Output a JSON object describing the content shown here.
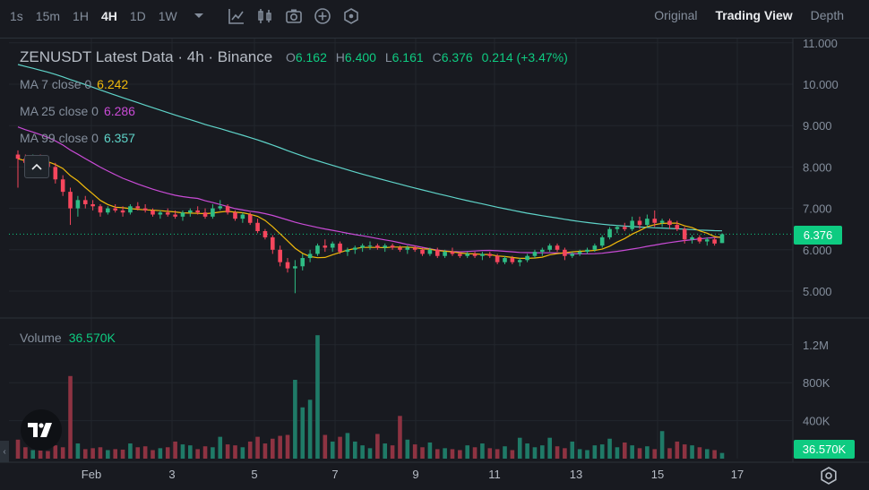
{
  "toolbar": {
    "timeframes": [
      "1s",
      "15m",
      "1H",
      "4H",
      "1D",
      "1W"
    ],
    "active_timeframe": "4H",
    "views": [
      "Original",
      "Trading View",
      "Depth"
    ],
    "active_view": "Trading View"
  },
  "legend": {
    "title": "ZENUSDT Latest Data · 4h · Binance",
    "open_key": "O",
    "open": "6.162",
    "high_key": "H",
    "high": "6.400",
    "low_key": "L",
    "low": "6.161",
    "close_key": "C",
    "close": "6.376",
    "change": "0.214 (+3.47%)"
  },
  "ma": [
    {
      "label": "MA 7 close 0",
      "value": "6.242",
      "color": "#f0b90b"
    },
    {
      "label": "MA 25 close 0",
      "value": "6.286",
      "color": "#c94bd6"
    },
    {
      "label": "MA 99 close 0",
      "value": "6.357",
      "color": "#5fd4c9"
    }
  ],
  "volume": {
    "label": "Volume",
    "value": "36.570K",
    "tag": "36.570K"
  },
  "price_tag": "6.376",
  "colors": {
    "up": "#2ebd85",
    "down": "#f6465d",
    "up_vol": "#1f7a67",
    "down_vol": "#8e3342"
  },
  "chart_data": {
    "type": "candlestick",
    "price_axis": {
      "ticks": [
        "11.000",
        "10.000",
        "9.000",
        "8.000",
        "7.000",
        "6.000",
        "5.000"
      ],
      "min": 4.5,
      "max": 11.2
    },
    "volume_axis": {
      "ticks": [
        "1.2M",
        "800K",
        "400K"
      ],
      "max": 1300000
    },
    "x_ticks": [
      "Feb",
      "3",
      "5",
      "7",
      "9",
      "11",
      "13",
      "15",
      "17"
    ],
    "last_price": 6.376,
    "ohlc": [
      [
        8.3,
        8.4,
        7.5,
        8.2
      ],
      [
        8.2,
        8.3,
        7.9,
        8.1
      ],
      [
        8.1,
        8.3,
        8.0,
        8.25
      ],
      [
        8.25,
        8.3,
        8.05,
        8.1
      ],
      [
        8.1,
        8.2,
        7.9,
        8.0
      ],
      [
        8.0,
        8.1,
        7.6,
        7.7
      ],
      [
        7.7,
        7.8,
        7.3,
        7.4
      ],
      [
        7.4,
        7.5,
        6.6,
        7.0
      ],
      [
        7.0,
        7.3,
        6.8,
        7.2
      ],
      [
        7.2,
        7.3,
        7.0,
        7.1
      ],
      [
        7.1,
        7.2,
        6.95,
        7.05
      ],
      [
        7.05,
        7.1,
        6.8,
        6.9
      ],
      [
        6.9,
        7.05,
        6.85,
        7.0
      ],
      [
        7.0,
        7.1,
        6.9,
        6.95
      ],
      [
        6.95,
        7.05,
        6.8,
        6.9
      ],
      [
        6.9,
        7.1,
        6.85,
        7.05
      ],
      [
        7.05,
        7.15,
        6.95,
        7.0
      ],
      [
        7.0,
        7.1,
        6.9,
        6.95
      ],
      [
        6.95,
        7.0,
        6.8,
        6.85
      ],
      [
        6.85,
        6.95,
        6.75,
        6.9
      ],
      [
        6.9,
        7.0,
        6.8,
        6.85
      ],
      [
        6.85,
        6.95,
        6.75,
        6.8
      ],
      [
        6.8,
        6.95,
        6.7,
        6.9
      ],
      [
        6.9,
        7.0,
        6.8,
        6.95
      ],
      [
        6.95,
        7.05,
        6.85,
        6.9
      ],
      [
        6.9,
        7.0,
        6.75,
        6.8
      ],
      [
        6.8,
        7.1,
        6.75,
        7.0
      ],
      [
        7.0,
        7.2,
        6.95,
        7.05
      ],
      [
        7.05,
        7.1,
        6.85,
        6.9
      ],
      [
        6.9,
        6.95,
        6.7,
        6.75
      ],
      [
        6.75,
        6.9,
        6.65,
        6.85
      ],
      [
        6.85,
        6.9,
        6.6,
        6.65
      ],
      [
        6.65,
        6.75,
        6.4,
        6.45
      ],
      [
        6.45,
        6.5,
        6.25,
        6.3
      ],
      [
        6.3,
        6.35,
        5.9,
        6.0
      ],
      [
        6.0,
        6.1,
        5.6,
        5.7
      ],
      [
        5.7,
        5.8,
        5.45,
        5.55
      ],
      [
        5.55,
        5.75,
        4.95,
        5.6
      ],
      [
        5.6,
        5.9,
        5.5,
        5.8
      ],
      [
        5.8,
        6.0,
        5.7,
        5.9
      ],
      [
        5.9,
        6.15,
        5.85,
        6.1
      ],
      [
        6.1,
        6.25,
        5.95,
        6.05
      ],
      [
        6.05,
        6.2,
        5.95,
        6.15
      ],
      [
        6.15,
        6.2,
        5.9,
        5.95
      ],
      [
        5.95,
        6.05,
        5.85,
        6.0
      ],
      [
        6.0,
        6.1,
        5.9,
        6.05
      ],
      [
        6.05,
        6.15,
        5.95,
        6.1
      ],
      [
        6.1,
        6.2,
        6.0,
        6.1
      ],
      [
        6.1,
        6.15,
        6.0,
        6.05
      ],
      [
        6.05,
        6.15,
        5.95,
        6.1
      ],
      [
        6.1,
        6.15,
        6.0,
        6.05
      ],
      [
        6.05,
        6.1,
        5.95,
        6.0
      ],
      [
        6.0,
        6.1,
        5.9,
        6.05
      ],
      [
        6.05,
        6.1,
        5.95,
        6.0
      ],
      [
        6.0,
        6.05,
        5.85,
        5.9
      ],
      [
        5.9,
        6.05,
        5.85,
        6.0
      ],
      [
        6.0,
        6.05,
        5.8,
        5.85
      ],
      [
        5.85,
        6.0,
        5.8,
        5.95
      ],
      [
        5.95,
        6.05,
        5.85,
        5.9
      ],
      [
        5.9,
        5.95,
        5.8,
        5.85
      ],
      [
        5.85,
        5.95,
        5.8,
        5.9
      ],
      [
        5.9,
        5.95,
        5.8,
        5.85
      ],
      [
        5.85,
        5.95,
        5.75,
        5.9
      ],
      [
        5.9,
        5.95,
        5.8,
        5.85
      ],
      [
        5.85,
        5.9,
        5.65,
        5.7
      ],
      [
        5.7,
        5.85,
        5.65,
        5.8
      ],
      [
        5.8,
        5.85,
        5.65,
        5.7
      ],
      [
        5.7,
        5.8,
        5.6,
        5.75
      ],
      [
        5.75,
        5.9,
        5.7,
        5.85
      ],
      [
        5.85,
        6.0,
        5.8,
        5.95
      ],
      [
        5.95,
        6.05,
        5.85,
        6.0
      ],
      [
        6.0,
        6.15,
        5.95,
        6.1
      ],
      [
        6.1,
        6.15,
        5.95,
        6.0
      ],
      [
        6.0,
        6.05,
        5.75,
        5.85
      ],
      [
        5.85,
        5.95,
        5.8,
        5.9
      ],
      [
        5.9,
        6.0,
        5.85,
        5.95
      ],
      [
        5.95,
        6.05,
        5.9,
        6.0
      ],
      [
        6.0,
        6.15,
        5.95,
        6.1
      ],
      [
        6.1,
        6.35,
        6.05,
        6.3
      ],
      [
        6.3,
        6.55,
        6.25,
        6.5
      ],
      [
        6.5,
        6.6,
        6.4,
        6.55
      ],
      [
        6.55,
        6.65,
        6.45,
        6.5
      ],
      [
        6.5,
        6.8,
        6.45,
        6.7
      ],
      [
        6.7,
        6.8,
        6.5,
        6.6
      ],
      [
        6.6,
        6.85,
        6.55,
        6.75
      ],
      [
        6.75,
        6.95,
        6.55,
        6.65
      ],
      [
        6.65,
        6.75,
        6.55,
        6.7
      ],
      [
        6.7,
        6.75,
        6.5,
        6.6
      ],
      [
        6.6,
        6.7,
        6.45,
        6.5
      ],
      [
        6.5,
        6.55,
        6.15,
        6.25
      ],
      [
        6.25,
        6.35,
        6.15,
        6.3
      ],
      [
        6.3,
        6.35,
        6.15,
        6.2
      ],
      [
        6.2,
        6.3,
        6.1,
        6.25
      ],
      [
        6.25,
        6.3,
        6.1,
        6.15
      ],
      [
        6.162,
        6.4,
        6.161,
        6.376
      ]
    ],
    "volume_values": [
      200000,
      120000,
      90000,
      110000,
      80000,
      140000,
      120000,
      870000,
      160000,
      100000,
      110000,
      120000,
      90000,
      100000,
      95000,
      160000,
      120000,
      130000,
      90000,
      110000,
      120000,
      180000,
      150000,
      140000,
      100000,
      130000,
      120000,
      230000,
      150000,
      140000,
      120000,
      180000,
      230000,
      160000,
      210000,
      240000,
      250000,
      830000,
      540000,
      620000,
      1300000,
      250000,
      180000,
      230000,
      270000,
      180000,
      140000,
      110000,
      260000,
      160000,
      140000,
      450000,
      200000,
      150000,
      120000,
      170000,
      100000,
      110000,
      100000,
      90000,
      140000,
      120000,
      160000,
      110000,
      100000,
      130000,
      90000,
      220000,
      160000,
      120000,
      140000,
      220000,
      130000,
      110000,
      180000,
      100000,
      90000,
      140000,
      150000,
      210000,
      120000,
      170000,
      140000,
      110000,
      130000,
      100000,
      290000,
      110000,
      180000,
      150000,
      140000,
      120000,
      100000,
      90000,
      60000,
      50000
    ]
  }
}
